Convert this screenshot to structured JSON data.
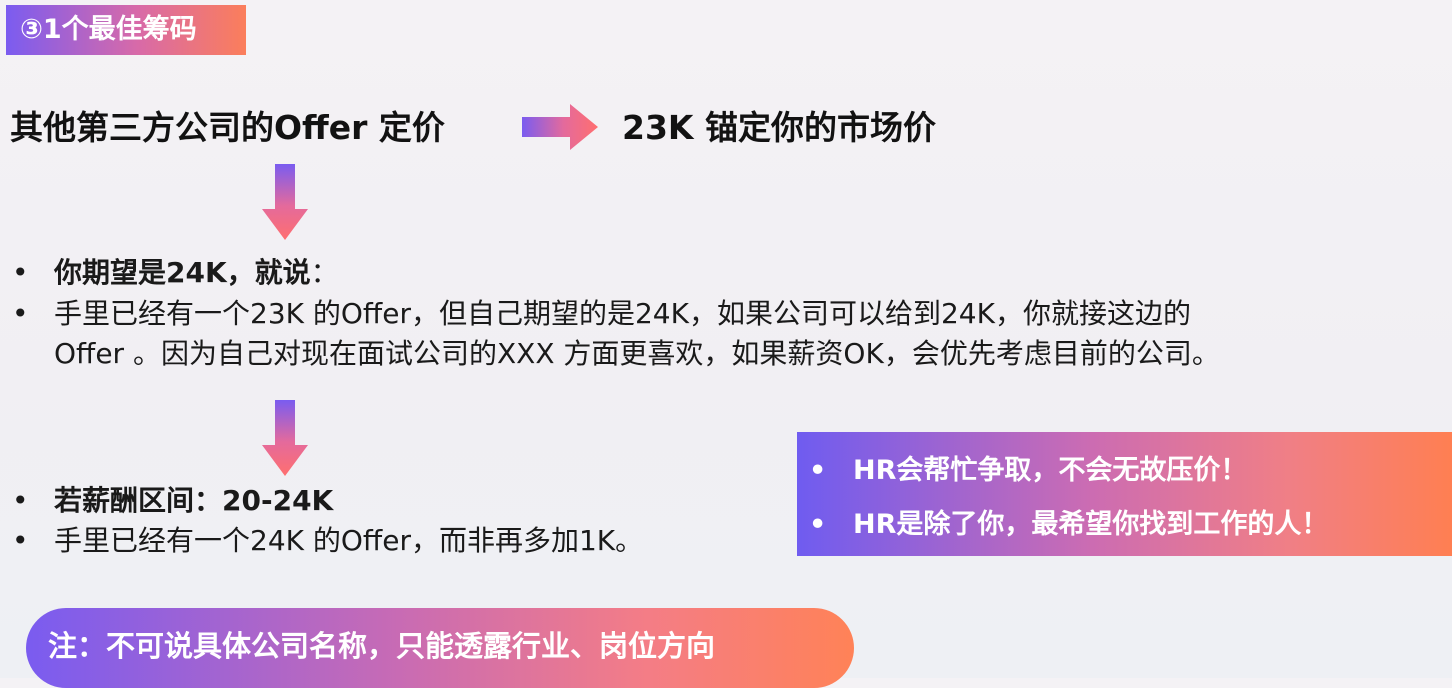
{
  "section": {
    "number": "③",
    "title": "1个最佳筹码"
  },
  "headline": {
    "left": "其他第三方公司的Offer 定价",
    "right": "23K 锚定你的市场价"
  },
  "bullets_1": {
    "marker": "•",
    "line1_bold": "你期望是24K，就说",
    "line1_colon": "：",
    "line2": "手里已经有一个23K 的Offer，但自己期望的是24K，如果公司可以给到24K，你就接这边的",
    "line3": "Offer 。因为自己对现在面试公司的XXX 方面更喜欢，如果薪资OK，会优先考虑目前的公司。"
  },
  "bullets_2": {
    "marker": "•",
    "line1_bold": "若薪酬区间：20-24K",
    "line2": "手里已经有一个24K 的Offer，而非再多加1K。"
  },
  "hr_box": {
    "marker": "•",
    "items": [
      "HR会帮忙争取，不会无故压价！",
      "HR是除了你，最希望你找到工作的人！"
    ]
  },
  "note": {
    "text": "注：不可说具体公司名称，只能透露行业、岗位方向"
  },
  "colors": {
    "gradient_start": "#7b5cf0",
    "gradient_mid": "#d86aa8",
    "gradient_end": "#ff7f52",
    "text": "#151515",
    "background": "#f2f0f4"
  }
}
